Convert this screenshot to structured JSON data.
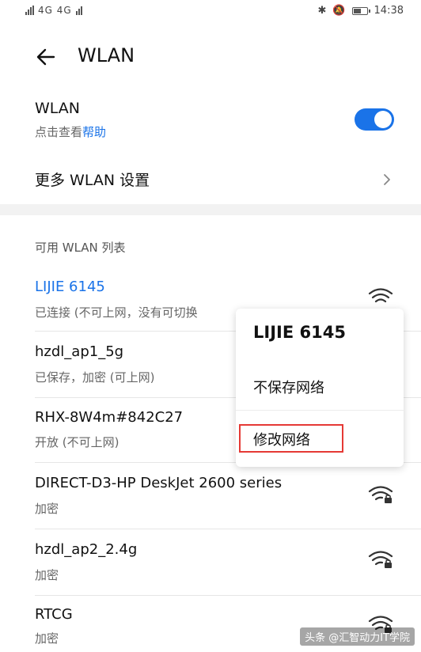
{
  "status_bar": {
    "left_text": "4G 4G",
    "time": "14:38",
    "battery_percent": 60
  },
  "header": {
    "title": "WLAN"
  },
  "wlan": {
    "label": "WLAN",
    "sub_prefix": "点击查看",
    "sub_help": "帮助",
    "enabled": true,
    "more_label": "更多 WLAN 设置"
  },
  "list": {
    "header": "可用 WLAN 列表",
    "networks": [
      {
        "name": "LIJIE 6145",
        "status": "已连接 (不可上网，没有可切换",
        "connected": true,
        "locked": false
      },
      {
        "name": "hzdl_ap1_5g",
        "status": "已保存，加密 (可上网)",
        "connected": false,
        "locked": true
      },
      {
        "name": "RHX-8W4m#842C27",
        "status": "开放 (不可上网)",
        "connected": false,
        "locked": false
      },
      {
        "name": "DIRECT-D3-HP DeskJet 2600 series",
        "status": "加密",
        "connected": false,
        "locked": true
      },
      {
        "name": "hzdl_ap2_2.4g",
        "status": "加密",
        "connected": false,
        "locked": true
      },
      {
        "name": "RTCG",
        "status": "加密",
        "connected": false,
        "locked": true
      }
    ]
  },
  "popup": {
    "title": "LIJIE 6145",
    "forget": "不保存网络",
    "modify": "修改网络"
  },
  "watermark": "头条 @汇智动力IT学院",
  "colors": {
    "accent": "#1a73e8",
    "highlight": "#e53935"
  }
}
